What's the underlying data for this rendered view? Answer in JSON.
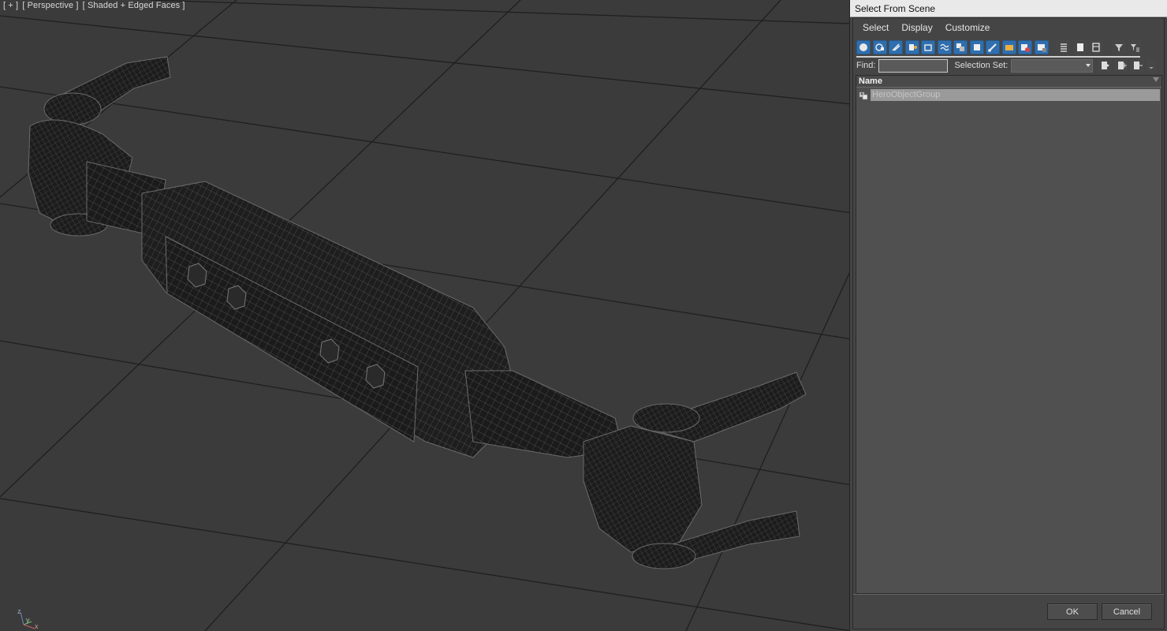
{
  "viewport": {
    "labels": [
      "[ + ]",
      "[ Perspective ]",
      "[ Shaded + Edged Faces ]"
    ],
    "gizmo_axes": [
      "z",
      "y",
      "x"
    ]
  },
  "dialog": {
    "title": "Select From Scene",
    "menu": [
      "Select",
      "Display",
      "Customize"
    ],
    "toolbar_icons": [
      "display-geometry-icon",
      "display-shapes-icon",
      "display-lights-icon",
      "display-cameras-icon",
      "display-helpers-icon",
      "display-spacewarps-icon",
      "display-groups-icon",
      "display-xrefs-icon",
      "display-bones-icon",
      "display-containers-icon",
      "display-frozen-icon",
      "display-hidden-icon",
      "list-view-icon",
      "none-view-icon",
      "all-view-icon",
      "filter-icon",
      "filter-options-icon"
    ],
    "find_label": "Find:",
    "find_value": "",
    "selection_set_label": "Selection Set:",
    "selection_set_value": "",
    "column_header": "Name",
    "rows": [
      {
        "name": "HeroObjectGroup",
        "icon": "group-icon"
      }
    ],
    "ok_label": "OK",
    "cancel_label": "Cancel"
  },
  "colors": {
    "viewport_bg": "#3b3b3b",
    "grid": "#1e1e1e",
    "selection": "#9a9a9a",
    "toolbar_active": "#2f6fb0"
  }
}
